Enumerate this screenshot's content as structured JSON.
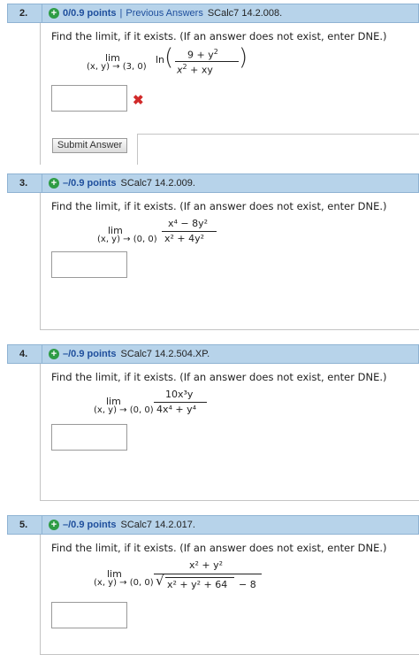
{
  "questions": [
    {
      "number": "2.",
      "points": "0/0.9 points",
      "separator": "|",
      "previous_answers": "Previous Answers",
      "code": "SCalc7 14.2.008.",
      "prompt": "Find the limit, if it exists. (If an answer does not exist, enter DNE.)",
      "lim": "lim",
      "lim_sub": "(x, y) → (3, 0)",
      "func": "ln",
      "numerator": "9 + y",
      "numerator_exp": "2",
      "denominator_a": "x",
      "denominator_exp": "2",
      "denominator_b": " + xy",
      "answer": "",
      "status": "incorrect",
      "submit_label": "Submit Answer"
    },
    {
      "number": "3.",
      "points": "–/0.9 points",
      "code": "SCalc7 14.2.009.",
      "prompt": "Find the limit, if it exists. (If an answer does not exist, enter DNE.)",
      "lim": "lim",
      "lim_sub": "(x, y) → (0, 0)",
      "numerator": "x⁴ − 8y²",
      "denominator": "x² + 4y²",
      "answer": ""
    },
    {
      "number": "4.",
      "points": "–/0.9 points",
      "code": "SCalc7 14.2.504.XP.",
      "prompt": "Find the limit, if it exists. (If an answer does not exist, enter DNE.)",
      "lim": "lim",
      "lim_sub": "(x, y) → (0, 0)",
      "numerator": "10x³y",
      "denominator": "4x⁴ + y⁴",
      "answer": ""
    },
    {
      "number": "5.",
      "points": "–/0.9 points",
      "code": "SCalc7 14.2.017.",
      "prompt": "Find the limit, if it exists. (If an answer does not exist, enter DNE.)",
      "lim": "lim",
      "lim_sub": "(x, y) → (0, 0)",
      "numerator": "x² + y²",
      "denominator_root": "x² + y² + 64",
      "denominator_tail": "− 8",
      "answer": ""
    }
  ],
  "colors": {
    "header_bg": "#b7d3ea",
    "link": "#1e4e9c",
    "plus_green": "#2e9c45",
    "error_red": "#d12a2a"
  },
  "icons": {
    "points_toggle": "plus-circle-icon",
    "incorrect": "x-mark-icon"
  }
}
